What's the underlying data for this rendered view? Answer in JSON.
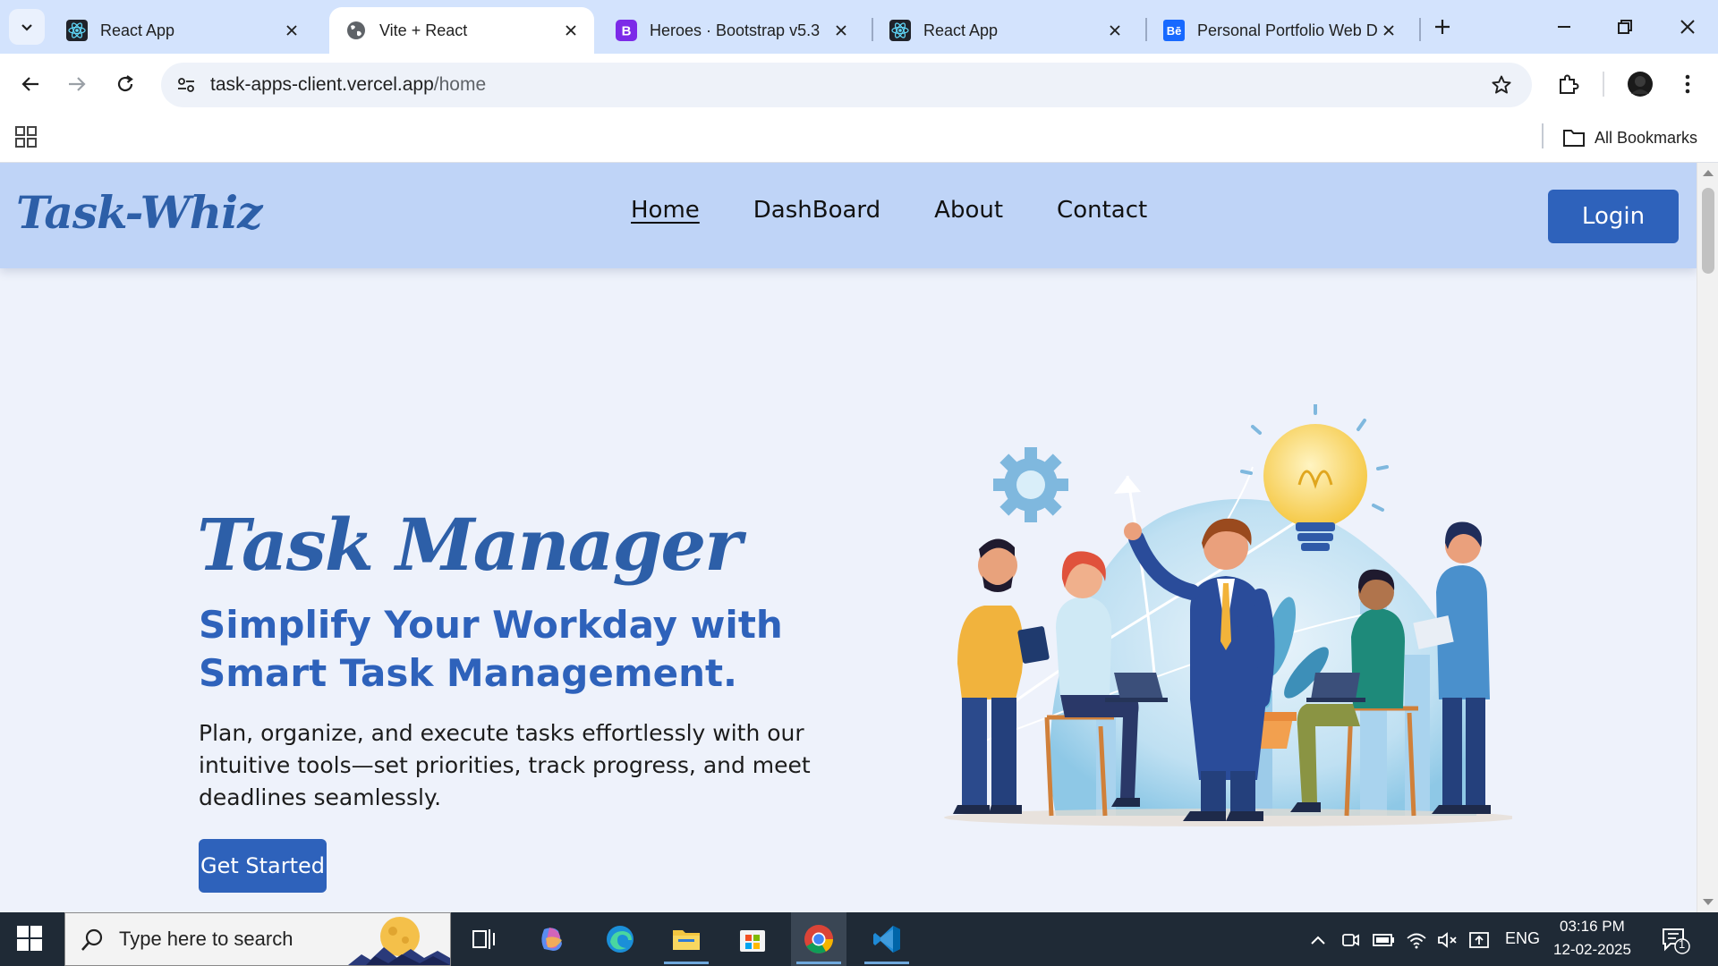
{
  "browser": {
    "tabs": [
      {
        "title": "React App",
        "favicon": "react-icon",
        "active": false
      },
      {
        "title": "Vite + React",
        "favicon": "globe-icon",
        "active": true
      },
      {
        "title": "Heroes · Bootstrap v5.3",
        "favicon": "bootstrap-icon",
        "active": false
      },
      {
        "title": "React App",
        "favicon": "react-icon",
        "active": false
      },
      {
        "title": "Personal Portfolio Web D",
        "favicon": "behance-icon",
        "active": false
      }
    ],
    "address": {
      "domain": "task-apps-client.vercel.app",
      "path": "/home"
    },
    "bookmarks": {
      "all_label": "All Bookmarks"
    }
  },
  "site": {
    "logo": "Task-Whiz",
    "nav": [
      {
        "label": "Home",
        "current": true
      },
      {
        "label": "DashBoard",
        "current": false
      },
      {
        "label": "About",
        "current": false
      },
      {
        "label": "Contact",
        "current": false
      }
    ],
    "login_label": "Login"
  },
  "hero": {
    "title": "Task Manager",
    "subtitle": "Simplify Your Workday with Smart Task Management.",
    "description": "Plan, organize, and execute tasks effortlessly with our intuitive tools—set priorities, track progress, and meet deadlines seamlessly.",
    "cta_label": "Get Started",
    "illustration": "team-collaboration-illustration"
  },
  "taskbar": {
    "search_placeholder": "Type here to search",
    "apps": [
      "task-view-icon",
      "copilot-icon",
      "edge-icon",
      "file-explorer-icon",
      "microsoft-store-icon",
      "chrome-icon",
      "vscode-icon"
    ],
    "language": "ENG",
    "time": "03:16 PM",
    "date": "12-02-2025",
    "notification_count": "1"
  },
  "colors": {
    "tabstrip": "#d3e3fd",
    "header": "#bfd4f7",
    "brand_blue": "#2e62bb",
    "logo_blue": "#2d5fa8",
    "page_bg": "#eef2fb",
    "taskbar": "#1f2a36"
  }
}
